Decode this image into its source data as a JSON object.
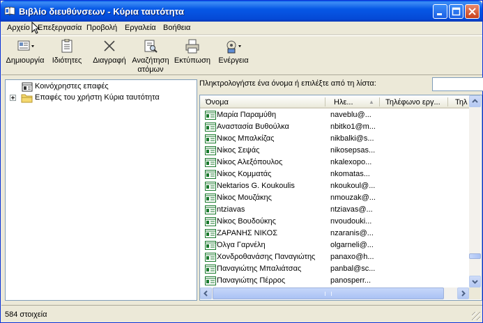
{
  "window": {
    "title": "Βιβλίο διευθύνσεων - Κύρια ταυτότητα",
    "title_color": "#0a5ce8"
  },
  "menubar": {
    "items": [
      "Αρχείο",
      "Επεξεργασία",
      "Προβολή",
      "Εργαλεία",
      "Βοήθεια"
    ]
  },
  "toolbar": {
    "new_label": "Δημιουργία",
    "properties_label": "Ιδιότητες",
    "delete_label": "Διαγραφή",
    "find_label_1": "Αναζήτηση",
    "find_label_2": "ατόμων",
    "print_label": "Εκτύπωση",
    "action_label": "Ενέργεια"
  },
  "tree": {
    "items": [
      "Κοινόχρηστες επαφές",
      "Επαφές του χρήστη Κύρια ταυτότητα"
    ]
  },
  "search": {
    "prompt": "Πληκτρολογήστε ένα όνομα ή επιλέξτε από τη λίστα:",
    "value": ""
  },
  "list": {
    "columns": [
      "Όνομα",
      "Ηλε...",
      "Τηλέφωνο εργ...",
      "Τηλ"
    ],
    "sort_indicator": "▲",
    "rows": [
      {
        "name": "Μαρία Παραμύθη",
        "email": "naveblu@..."
      },
      {
        "name": "Αναστασία Βυθούλκα",
        "email": "nbitko1@m..."
      },
      {
        "name": "Νικος Μπαλκίζας",
        "email": "nikbalki@s..."
      },
      {
        "name": "Νίκος Σεψάς",
        "email": "nikosepsas..."
      },
      {
        "name": "Νίκος Αλεξόπουλος",
        "email": "nkalexopo..."
      },
      {
        "name": "Νίκος Κομματάς",
        "email": "nkomatas..."
      },
      {
        "name": "Nektarios G. Koukoulis",
        "email": "nkoukoul@..."
      },
      {
        "name": "Νίκος Μουζάκης",
        "email": "nmouzak@..."
      },
      {
        "name": "ntziavas",
        "email": "ntziavas@..."
      },
      {
        "name": "Νίκος Βουδούκης",
        "email": "nvoudouki..."
      },
      {
        "name": "ΖΑΡΑΝΗΣ ΝΙΚΟΣ",
        "email": "nzaranis@..."
      },
      {
        "name": "Όλγα Γαρνέλη",
        "email": "olgarneli@..."
      },
      {
        "name": "Χονδροθανάσης Παναγιώτης",
        "email": "panaxo@h..."
      },
      {
        "name": "Παναγιώτης Μπαλιάτσας",
        "email": "panbal@sc..."
      },
      {
        "name": "Παναγιώτης Πέρρος",
        "email": "panosperr..."
      }
    ]
  },
  "status": {
    "text": "584 στοιχεία"
  },
  "colors": {
    "selection_border": "#7f9db9",
    "scrollbar": "#c6d7fa"
  },
  "icons": [
    "book-icon",
    "minimize-icon",
    "maximize-icon",
    "close-icon",
    "new-contact-icon",
    "properties-icon",
    "delete-icon",
    "find-people-icon",
    "print-icon",
    "action-icon",
    "contact-card-icon",
    "folder-icon",
    "shared-contacts-icon"
  ]
}
